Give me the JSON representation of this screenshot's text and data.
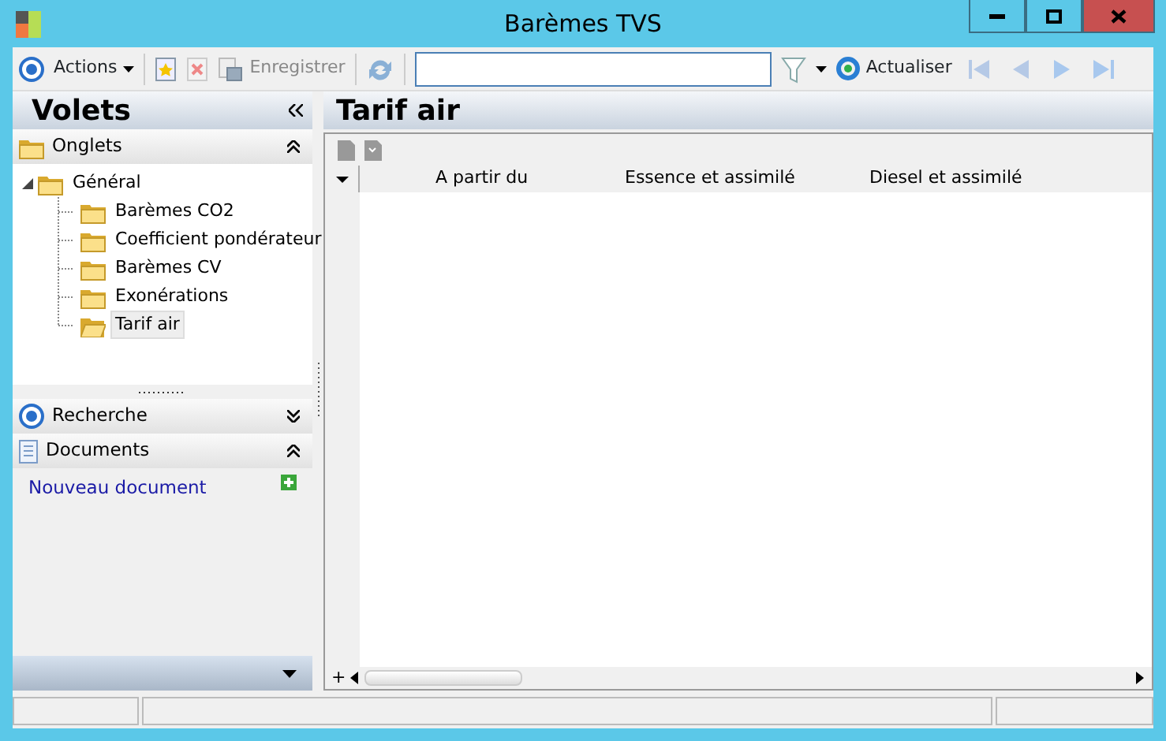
{
  "window": {
    "title": "Barèmes TVS"
  },
  "toolbar": {
    "actions_label": "Actions",
    "save_label": "Enregistrer",
    "save_disabled": true,
    "refresh_label": "Actualiser"
  },
  "sidebar": {
    "title": "Volets",
    "groups": [
      {
        "kind": "tree",
        "label": "Onglets",
        "expanded": true,
        "items": [
          {
            "label": "Général",
            "expanded": true,
            "selected": false,
            "children": [
              {
                "label": "Barèmes CO2",
                "selected": false
              },
              {
                "label": "Coefficient pondérateur",
                "selected": false
              },
              {
                "label": "Barèmes CV",
                "selected": false
              },
              {
                "label": "Exonérations",
                "selected": false
              },
              {
                "label": "Tarif air",
                "selected": true
              }
            ]
          }
        ]
      },
      {
        "kind": "search",
        "label": "Recherche",
        "expanded": false
      },
      {
        "kind": "documents",
        "label": "Documents",
        "expanded": true,
        "links": [
          "Nouveau document"
        ]
      }
    ]
  },
  "main": {
    "title": "Tarif air",
    "columns": [
      "A partir du",
      "Essence et assimilé",
      "Diesel et assimilé"
    ],
    "new_row_glyph": "+"
  }
}
